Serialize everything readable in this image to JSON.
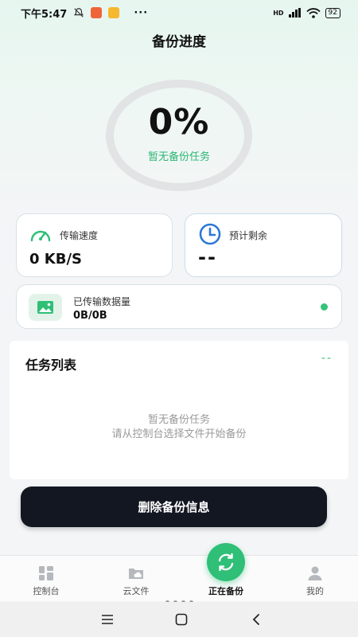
{
  "status_bar": {
    "time": "下午5:47",
    "network": "HD",
    "battery": "92",
    "more": "···"
  },
  "header": {
    "title": "备份进度"
  },
  "progress": {
    "percent_text": "0%",
    "subtitle": "暂无备份任务",
    "value": 0
  },
  "stats": {
    "speed": {
      "label": "传输速度",
      "value": "0 KB/S",
      "icon": "speedometer-icon"
    },
    "remaining": {
      "label": "预计剩余",
      "value": "--",
      "icon": "clock-icon"
    },
    "transferred": {
      "label": "已传输数据量",
      "value": "0B/0B",
      "icon": "image-icon"
    }
  },
  "task_list": {
    "title": "任务列表",
    "indicator": "--",
    "empty_line1": "暂无备份任务",
    "empty_line2": "请从控制台选择文件开始备份"
  },
  "actions": {
    "delete_label": "删除备份信息"
  },
  "tabbar": {
    "tabs": [
      {
        "label": "控制台",
        "icon": "dashboard-icon"
      },
      {
        "label": "云文件",
        "icon": "cloud-folder-icon"
      },
      {
        "label": "正在备份",
        "icon": "sync-icon",
        "active": true
      },
      {
        "label": "我的",
        "icon": "user-icon"
      }
    ]
  },
  "colors": {
    "accent": "#2fbf77",
    "button_dark": "#121722",
    "muted_text": "#9a9a9a"
  }
}
